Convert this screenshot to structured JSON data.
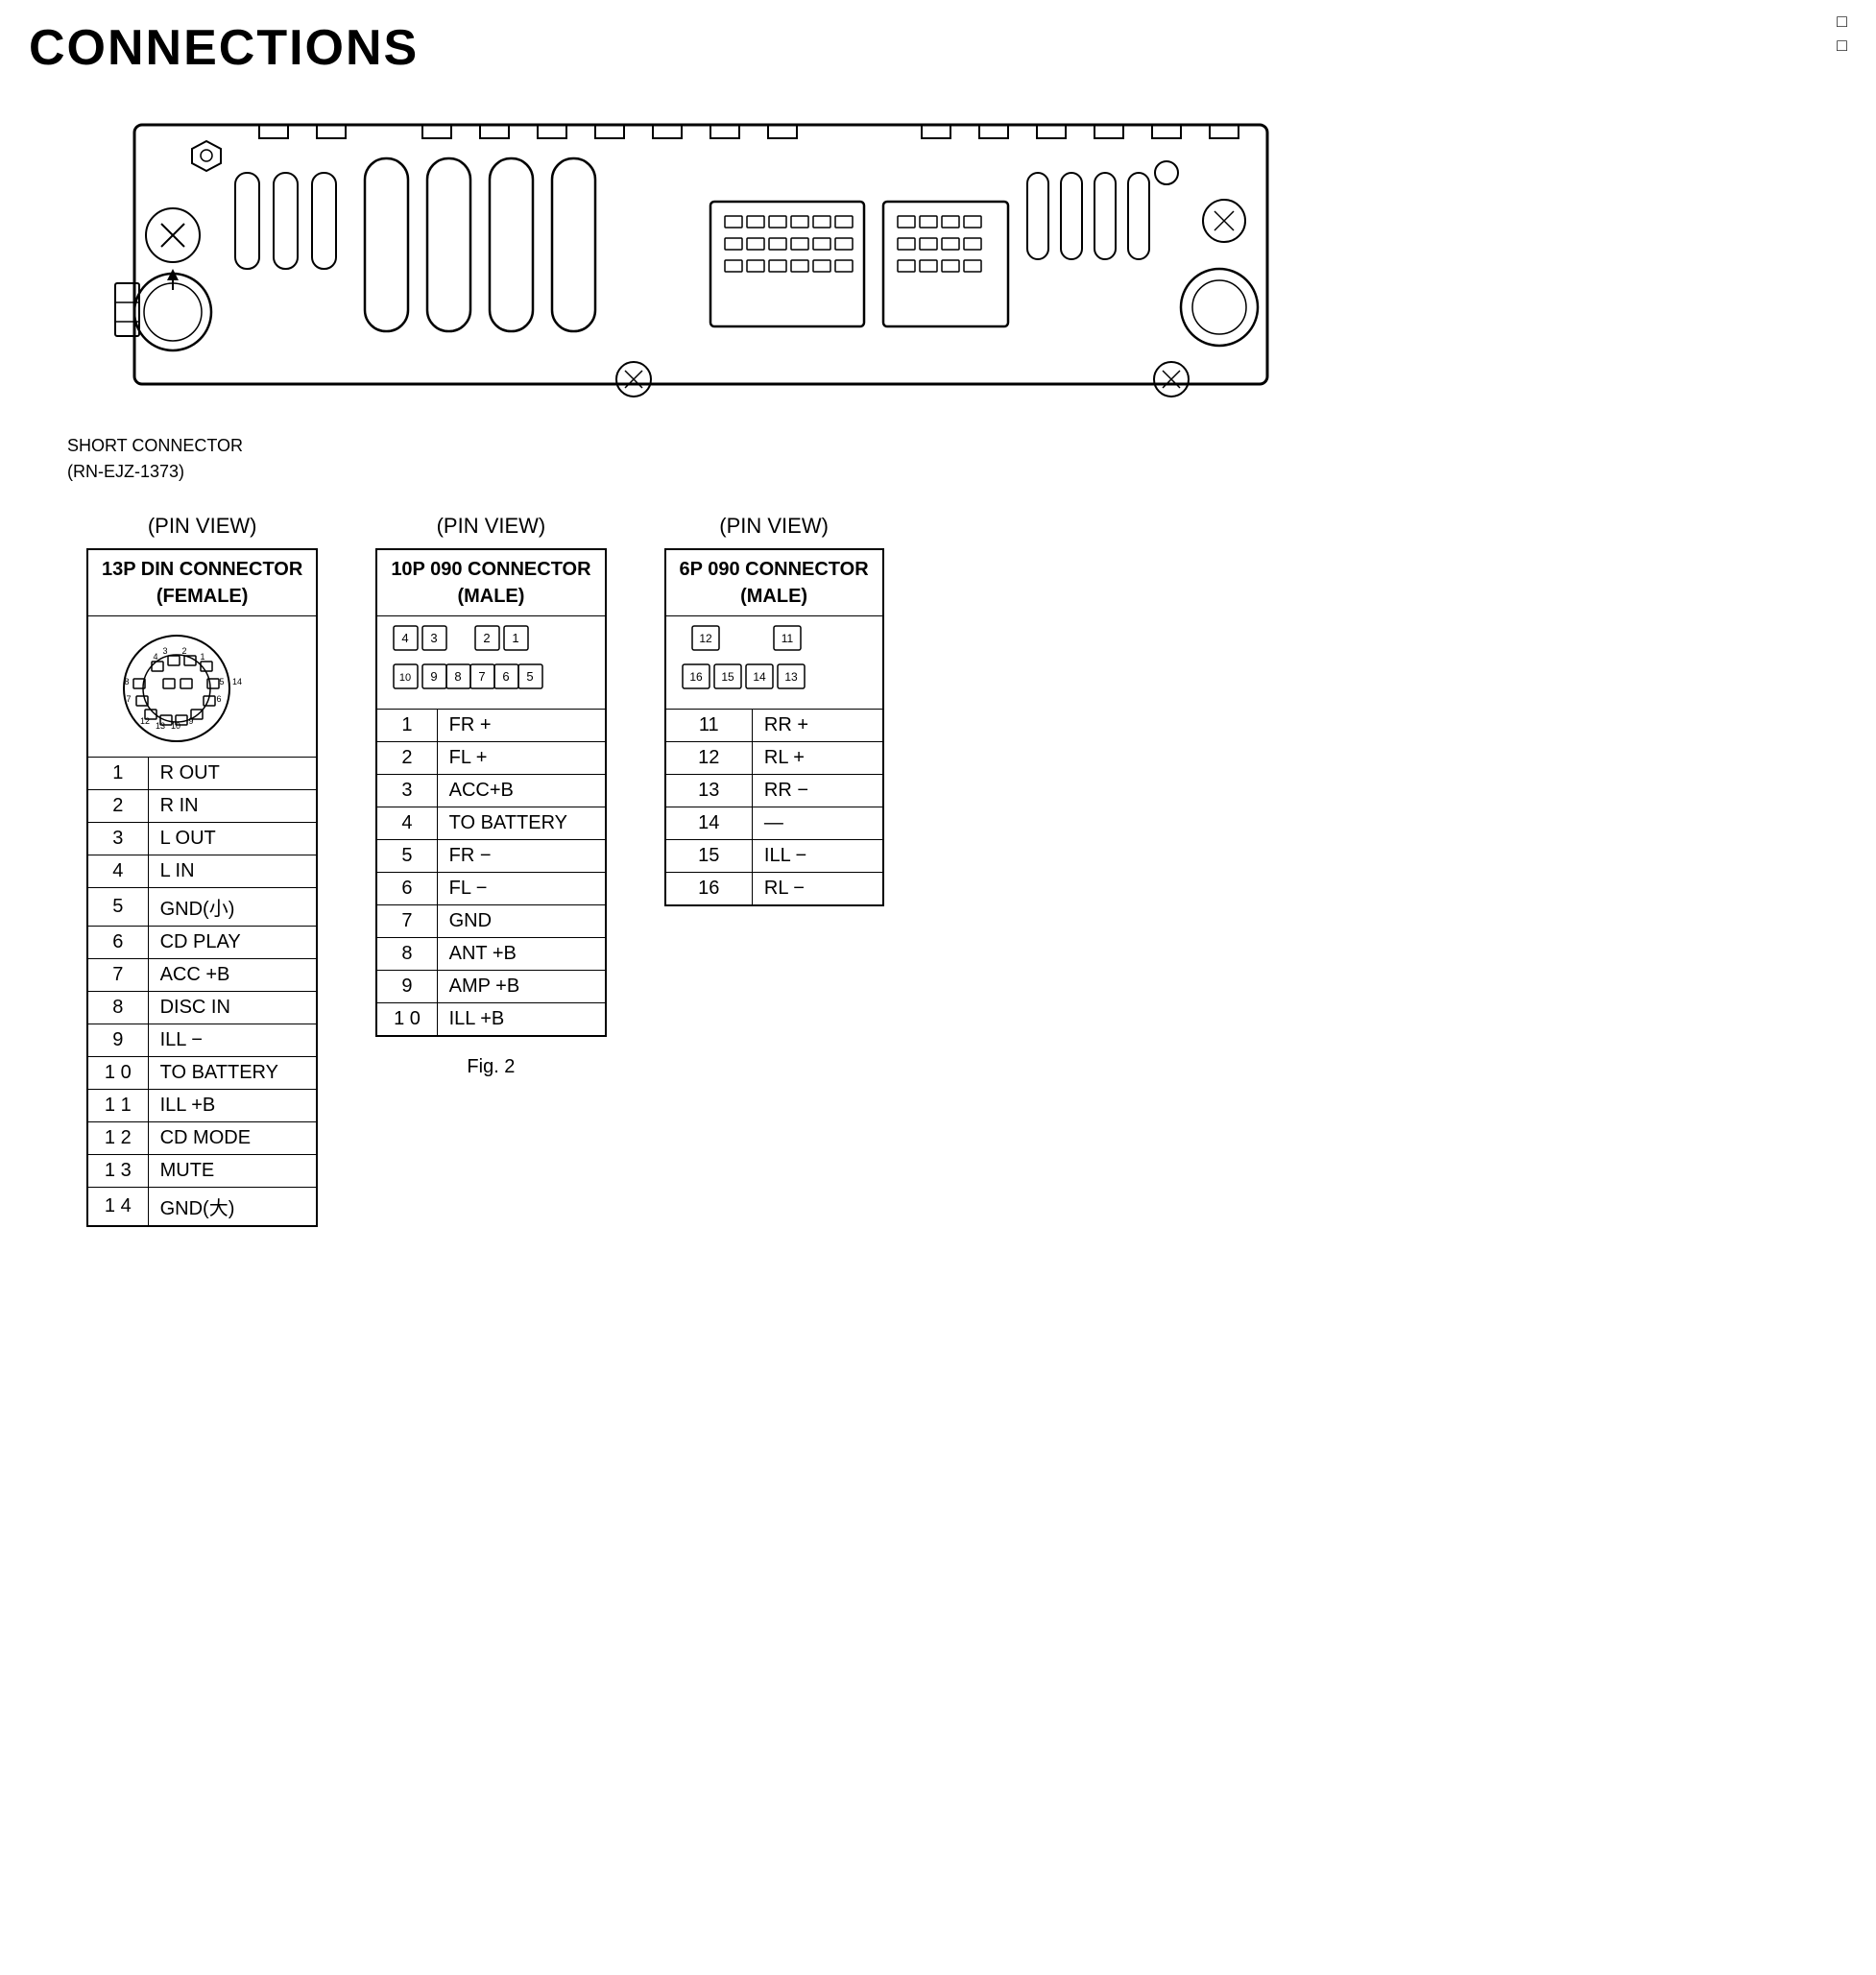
{
  "title": "CONNECTIONS",
  "corner_text": [
    "□",
    "□"
  ],
  "short_connector_label": "SHORT CONNECTOR",
  "short_connector_part": "(RN-EJZ-1373)",
  "pin_view_label": "(PIN  VIEW)",
  "connectors": [
    {
      "id": "13p-din",
      "title": "13P DIN CONNECTOR",
      "subtitle": "(FEMALE)",
      "pins": [
        {
          "num": "1",
          "signal": "R OUT"
        },
        {
          "num": "2",
          "signal": "R IN"
        },
        {
          "num": "3",
          "signal": "L OUT"
        },
        {
          "num": "4",
          "signal": "L IN"
        },
        {
          "num": "5",
          "signal": "GND(小)"
        },
        {
          "num": "6",
          "signal": "CD PLAY"
        },
        {
          "num": "7",
          "signal": "ACC +B"
        },
        {
          "num": "8",
          "signal": "DISC IN"
        },
        {
          "num": "9",
          "signal": "ILL −"
        },
        {
          "num": "1 0",
          "signal": "TO BATTERY"
        },
        {
          "num": "1 1",
          "signal": "ILL +B"
        },
        {
          "num": "1 2",
          "signal": "CD MODE"
        },
        {
          "num": "1 3",
          "signal": "MUTE"
        },
        {
          "num": "1 4",
          "signal": "GND(大)"
        }
      ]
    },
    {
      "id": "10p-090",
      "title": "10P 090 CONNECTOR",
      "subtitle": "(MALE)",
      "pins": [
        {
          "num": "1",
          "signal": "FR +"
        },
        {
          "num": "2",
          "signal": "FL +"
        },
        {
          "num": "3",
          "signal": "ACC+B"
        },
        {
          "num": "4",
          "signal": "TO BATTERY"
        },
        {
          "num": "5",
          "signal": "FR −"
        },
        {
          "num": "6",
          "signal": "FL −"
        },
        {
          "num": "7",
          "signal": "GND"
        },
        {
          "num": "8",
          "signal": "ANT +B"
        },
        {
          "num": "9",
          "signal": "AMP +B"
        },
        {
          "num": "1 0",
          "signal": "ILL +B"
        }
      ]
    },
    {
      "id": "6p-090",
      "title": "6P 090 CONNECTOR",
      "subtitle": "(MALE)",
      "pins": [
        {
          "num": "11",
          "signal": "RR +"
        },
        {
          "num": "12",
          "signal": "RL +"
        },
        {
          "num": "13",
          "signal": "RR −"
        },
        {
          "num": "14",
          "signal": "—"
        },
        {
          "num": "15",
          "signal": "ILL −"
        },
        {
          "num": "16",
          "signal": "RL −"
        }
      ]
    }
  ],
  "fig_label": "Fig. 2"
}
